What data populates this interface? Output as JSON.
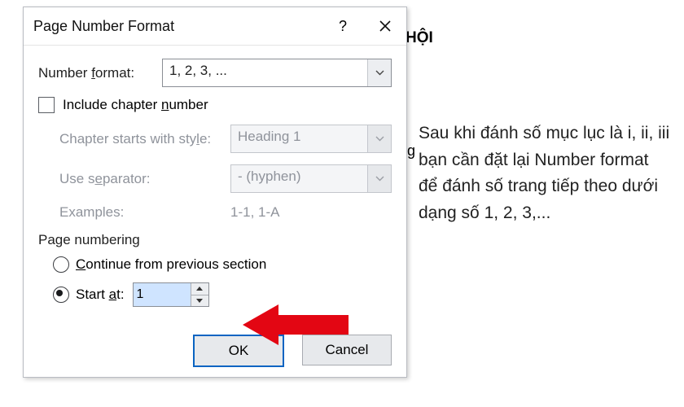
{
  "background": {
    "hoi": "HỘI",
    "g": "g"
  },
  "dialog": {
    "title": "Page Number Format",
    "number_format": {
      "label_pre": "Number ",
      "label_u": "f",
      "label_post": "ormat:",
      "value": "1, 2, 3, ..."
    },
    "include_chapter": {
      "label_pre": "Include chapter ",
      "label_u": "n",
      "label_post": "umber",
      "checked": false
    },
    "chapter_style": {
      "label_pre": "Chapter starts with sty",
      "label_u": "l",
      "label_post": "e:",
      "value": "Heading 1"
    },
    "separator": {
      "label_pre": "Use s",
      "label_u": "e",
      "label_post": "parator:",
      "value": "-  (hyphen)"
    },
    "examples": {
      "label": "Examples:",
      "value": "1-1, 1-A"
    },
    "page_numbering": {
      "group": "Page numbering",
      "continue": {
        "pre": "",
        "u": "C",
        "post": "ontinue from previous section"
      },
      "start_at": {
        "pre": "Start ",
        "u": "a",
        "post": "t:",
        "value": "1"
      },
      "selected": "start_at"
    },
    "buttons": {
      "ok": "OK",
      "cancel": "Cancel"
    }
  },
  "annotation": "Sau khi đánh số mục lục là i, ii, iii bạn cần đặt lại Number format để đánh số trang tiếp theo dưới dạng số 1, 2, 3,..."
}
